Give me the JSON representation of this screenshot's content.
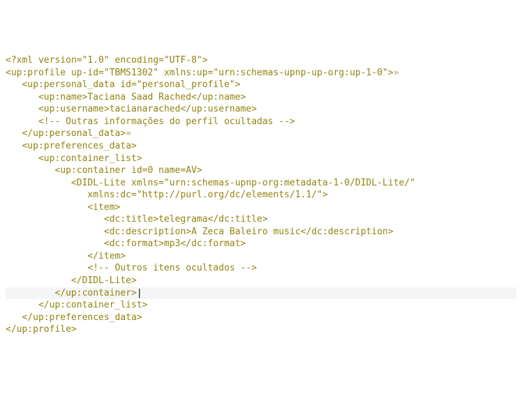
{
  "code": {
    "lines": [
      {
        "indent": 0,
        "text": "<?xml version=\"1.0\" encoding=\"UTF-8\">",
        "suffix": ""
      },
      {
        "indent": 0,
        "text": "<up:profile up-id=\"TBMS1302\" xmlns:up=\"urn:schemas-upnp-up-org:up-1-0\">",
        "suffix": "»"
      },
      {
        "indent": 0,
        "text": "",
        "suffix": ""
      },
      {
        "indent": 1,
        "text": "<up:personal_data id=\"personal_profile\">",
        "suffix": ""
      },
      {
        "indent": 2,
        "text": "<up:name>Taciana Saad Rached</up:name>",
        "suffix": ""
      },
      {
        "indent": 2,
        "text": "<up:username>tacianarached</up:username>",
        "suffix": ""
      },
      {
        "indent": 2,
        "text": "<!-- Outras informações do perfil ocultadas -->",
        "suffix": ""
      },
      {
        "indent": 1,
        "text": "</up:personal_data>",
        "suffix": "»"
      },
      {
        "indent": 0,
        "text": "",
        "suffix": ""
      },
      {
        "indent": 1,
        "text": "<up:preferences_data>",
        "suffix": ""
      },
      {
        "indent": 2,
        "text": "<up:container_list>",
        "suffix": ""
      },
      {
        "indent": 3,
        "text": "<up:container id=0 name=AV>",
        "suffix": ""
      },
      {
        "indent": 4,
        "text": "<DIDL-Lite xmlns=\"urn:schemas-upnp-org:metadata-1-0/DIDL-Lite/\"",
        "suffix": ""
      },
      {
        "indent": 5,
        "text": "xmlns:dc=\"http://purl.org/dc/elements/1.1/\">",
        "suffix": ""
      },
      {
        "indent": 5,
        "text": "<item>",
        "suffix": ""
      },
      {
        "indent": 6,
        "text": "<dc:title>telegrama</dc:title>",
        "suffix": ""
      },
      {
        "indent": 6,
        "text": "<dc:description>A Zeca Baleiro music</dc:description>",
        "suffix": ""
      },
      {
        "indent": 6,
        "text": "<dc:format>mp3</dc:format>",
        "suffix": ""
      },
      {
        "indent": 5,
        "text": "</item>",
        "suffix": ""
      },
      {
        "indent": 5,
        "text": "<!-- Outros itens ocultados -->",
        "suffix": ""
      },
      {
        "indent": 4,
        "text": "</DIDL-Lite>",
        "suffix": ""
      },
      {
        "indent": 3,
        "text": "</up:container>",
        "suffix": "",
        "highlight": true,
        "cursor": true
      },
      {
        "indent": 2,
        "text": "</up:container_list>",
        "suffix": ""
      },
      {
        "indent": 1,
        "text": "</up:preferences_data>",
        "suffix": ""
      },
      {
        "indent": 0,
        "text": "</up:profile>",
        "suffix": ""
      }
    ]
  }
}
